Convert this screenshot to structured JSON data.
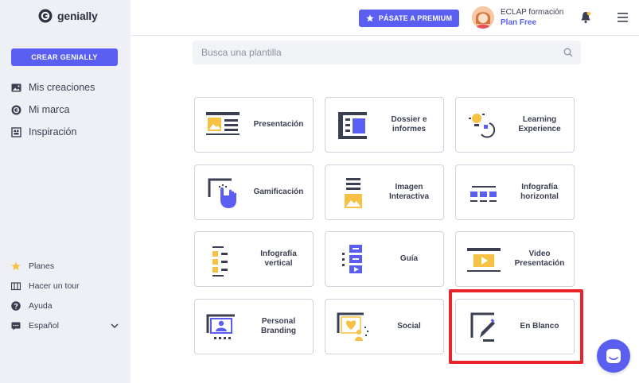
{
  "brand": {
    "name": "genially"
  },
  "sidebar": {
    "create_label": "CREAR GENIALLY",
    "items": [
      {
        "label": "Mis creaciones",
        "icon": "image-icon"
      },
      {
        "label": "Mi marca",
        "icon": "brand-icon"
      },
      {
        "label": "Inspiración",
        "icon": "inspiration-icon"
      }
    ],
    "bottom_items": [
      {
        "label": "Planes",
        "icon": "star-icon"
      },
      {
        "label": "Hacer un tour",
        "icon": "tour-icon"
      },
      {
        "label": "Ayuda",
        "icon": "help-icon"
      },
      {
        "label": "Español",
        "icon": "language-icon"
      }
    ]
  },
  "header": {
    "premium_label": "PÁSATE A PREMIUM",
    "user_name": "ECLAP formación",
    "user_plan": "Plan Free"
  },
  "search": {
    "placeholder": "Busca una plantilla"
  },
  "templates": [
    {
      "label": "Presentación",
      "icon": "presentation-icon"
    },
    {
      "label": "Dossier e\ninformes",
      "icon": "dossier-icon"
    },
    {
      "label": "Learning\nExperience",
      "icon": "learning-icon"
    },
    {
      "label": "Gamificación",
      "icon": "gamification-icon"
    },
    {
      "label": "Imagen\nInteractiva",
      "icon": "interactive-image-icon"
    },
    {
      "label": "Infografía\nhorizontal",
      "icon": "horizontal-infographic-icon"
    },
    {
      "label": "Infografía\nvertical",
      "icon": "vertical-infographic-icon"
    },
    {
      "label": "Guía",
      "icon": "guide-icon"
    },
    {
      "label": "Video\nPresentación",
      "icon": "video-presentation-icon"
    },
    {
      "label": "Personal\nBranding",
      "icon": "personal-branding-icon"
    },
    {
      "label": "Social",
      "icon": "social-icon"
    },
    {
      "label": "En Blanco",
      "icon": "blank-icon"
    }
  ],
  "colors": {
    "accent": "#5a5ff2",
    "yellow": "#f7c244",
    "highlight": "#e8242b",
    "sidebar_bg": "#eef0f6"
  }
}
